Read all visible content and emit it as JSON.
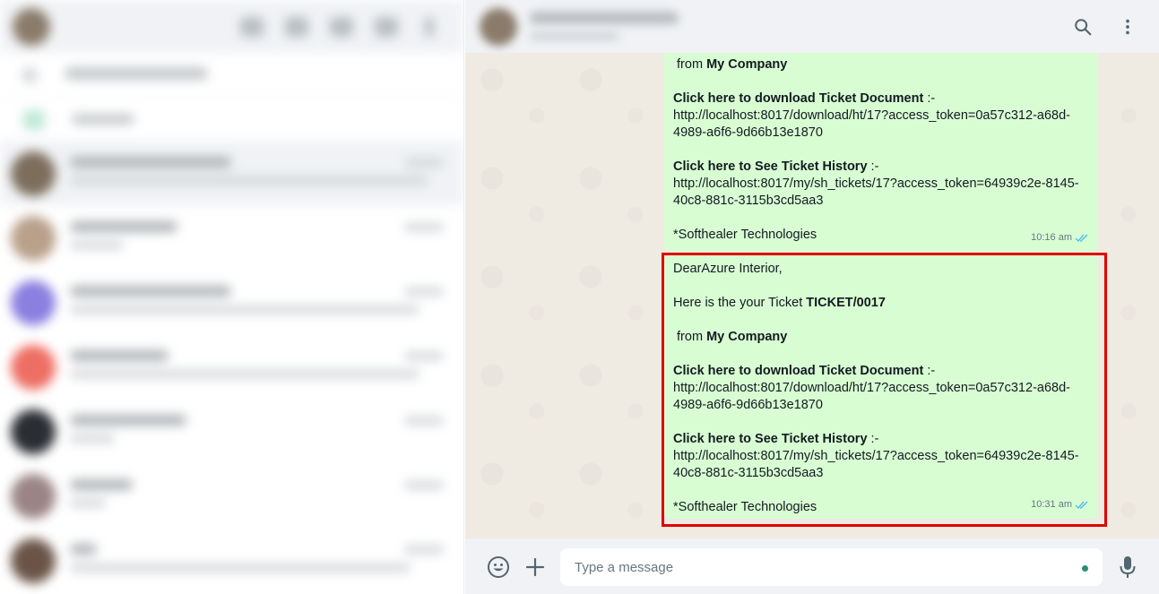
{
  "chat": {
    "search_icon": "search-icon",
    "menu_icon": "menu-dots-icon"
  },
  "messages": [
    {
      "lines": [
        {
          "parts": [
            {
              "text": " from ",
              "bold": false
            },
            {
              "text": "My Company",
              "bold": true
            }
          ]
        },
        {
          "parts": [
            {
              "text": "",
              "bold": false
            }
          ]
        },
        {
          "parts": [
            {
              "text": "Click here to download Ticket Document",
              "bold": true
            },
            {
              "text": " :-",
              "bold": false
            }
          ]
        },
        {
          "parts": [
            {
              "text": "http://localhost:8017/download/ht/17?access_token=0a57c312-a68d-4989-a6f6-9d66b13e1870",
              "bold": false
            }
          ]
        },
        {
          "parts": [
            {
              "text": "",
              "bold": false
            }
          ]
        },
        {
          "parts": [
            {
              "text": "Click here to See Ticket History",
              "bold": true
            },
            {
              "text": " :-",
              "bold": false
            }
          ]
        },
        {
          "parts": [
            {
              "text": "http://localhost:8017/my/sh_tickets/17?access_token=64939c2e-8145-40c8-881c-3115b3cd5aa3",
              "bold": false
            }
          ]
        },
        {
          "parts": [
            {
              "text": "",
              "bold": false
            }
          ]
        },
        {
          "parts": [
            {
              "text": "*Softhealer Technologies",
              "bold": false
            }
          ]
        }
      ],
      "time": "10:16 am",
      "status": "read"
    },
    {
      "lines": [
        {
          "parts": [
            {
              "text": "DearAzure Interior,",
              "bold": false
            }
          ]
        },
        {
          "parts": [
            {
              "text": "",
              "bold": false
            }
          ]
        },
        {
          "parts": [
            {
              "text": "Here is the your Ticket ",
              "bold": false
            },
            {
              "text": "TICKET/0017",
              "bold": true
            }
          ]
        },
        {
          "parts": [
            {
              "text": "",
              "bold": false
            }
          ]
        },
        {
          "parts": [
            {
              "text": " from ",
              "bold": false
            },
            {
              "text": "My Company",
              "bold": true
            }
          ]
        },
        {
          "parts": [
            {
              "text": "",
              "bold": false
            }
          ]
        },
        {
          "parts": [
            {
              "text": "Click here to download Ticket Document",
              "bold": true
            },
            {
              "text": " :-",
              "bold": false
            }
          ]
        },
        {
          "parts": [
            {
              "text": "http://localhost:8017/download/ht/17?access_token=0a57c312-a68d-4989-a6f6-9d66b13e1870",
              "bold": false
            }
          ]
        },
        {
          "parts": [
            {
              "text": "",
              "bold": false
            }
          ]
        },
        {
          "parts": [
            {
              "text": "Click here to See Ticket History",
              "bold": true
            },
            {
              "text": " :-",
              "bold": false
            }
          ]
        },
        {
          "parts": [
            {
              "text": "http://localhost:8017/my/sh_tickets/17?access_token=64939c2e-8145-40c8-881c-3115b3cd5aa3",
              "bold": false
            }
          ]
        },
        {
          "parts": [
            {
              "text": "",
              "bold": false
            }
          ]
        },
        {
          "parts": [
            {
              "text": "*Softhealer Technologies",
              "bold": false
            }
          ]
        }
      ],
      "time": "10:31 am",
      "status": "read"
    }
  ],
  "composer": {
    "placeholder": "Type a message",
    "emoji_icon": "emoji-icon",
    "attach_icon": "plus-icon",
    "mic_icon": "microphone-icon"
  },
  "colors": {
    "bubble_out": "#d9fdd3",
    "chat_bg": "#efeae2",
    "header_bg": "#f0f2f5",
    "read_ticks": "#53bdeb",
    "highlight": "#e00000"
  }
}
